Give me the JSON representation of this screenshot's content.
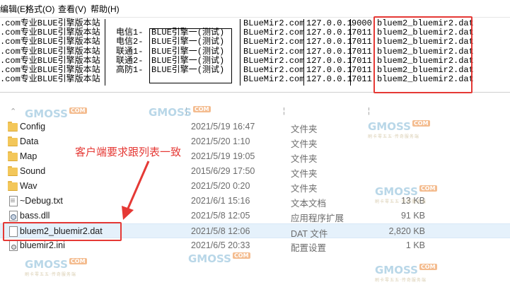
{
  "notepad": {
    "menu": [
      "编辑(E)",
      "格式(O)",
      "查看(V)",
      "帮助(H)"
    ],
    "lines": [
      {
        "site": ".com专业BLUE引擎版本站",
        "line_name": "",
        "engine": "",
        "domain": "BLueMir2.com",
        "ip": "127.0.0.1",
        "port": "9000",
        "file": "bluem2_bluemir2.dat"
      },
      {
        "site": ".com专业BLUE引擎版本站",
        "line_name": "电信1-",
        "engine": "BLUE引擎一(测试)",
        "domain": "BLueMir2.com",
        "ip": "127.0.0.1",
        "port": "7011",
        "file": "bluem2_bluemir2.dat"
      },
      {
        "site": ".com专业BLUE引擎版本站",
        "line_name": "电信2-",
        "engine": "BLUE引擎一(测试)",
        "domain": "BLueMir2.com",
        "ip": "127.0.0.1",
        "port": "7011",
        "file": "bluem2_bluemir2.dat"
      },
      {
        "site": ".com专业BLUE引擎版本站",
        "line_name": "联通1-",
        "engine": "BLUE引擎一(测试)",
        "domain": "BLueMir2.com",
        "ip": "127.0.0.1",
        "port": "7011",
        "file": "bluem2_bluemir2.dat"
      },
      {
        "site": ".com专业BLUE引擎版本站",
        "line_name": "联通2-",
        "engine": "BLUE引擎一(测试)",
        "domain": "BLueMir2.com",
        "ip": "127.0.0.1",
        "port": "7011",
        "file": "bluem2_bluemir2.dat"
      },
      {
        "site": ".com专业BLUE引擎版本站",
        "line_name": "高防1-",
        "engine": "BLUE引擎一(测试)",
        "domain": "BLueMir2.com",
        "ip": "127.0.0.1",
        "port": "7011",
        "file": "bluem2_bluemir2.dat"
      },
      {
        "site": ".com专业BLUE引擎版本站",
        "line_name": "",
        "engine": "",
        "domain": "BLueMir2.com",
        "ip": "127.0.0.1",
        "port": "7011",
        "file": "bluem2_bluemir2.dat"
      }
    ]
  },
  "explorer": {
    "files": [
      {
        "name": "Config",
        "date": "2021/5/19 16:47",
        "type": "文件夹",
        "size": "",
        "icon": "folder-icon"
      },
      {
        "name": "Data",
        "date": "2021/5/20 1:10",
        "type": "文件夹",
        "size": "",
        "icon": "folder-icon"
      },
      {
        "name": "Map",
        "date": "2021/5/19 19:05",
        "type": "文件夹",
        "size": "",
        "icon": "folder-icon"
      },
      {
        "name": "Sound",
        "date": "2015/6/29 17:50",
        "type": "文件夹",
        "size": "",
        "icon": "folder-icon"
      },
      {
        "name": "Wav",
        "date": "2021/5/20 0:20",
        "type": "文件夹",
        "size": "",
        "icon": "folder-icon"
      },
      {
        "name": "~Debug.txt",
        "date": "2021/6/1 15:16",
        "type": "文本文档",
        "size": "13 KB",
        "icon": "text-file-icon"
      },
      {
        "name": "bass.dll",
        "date": "2021/5/8 12:05",
        "type": "应用程序扩展",
        "size": "91 KB",
        "icon": "dll-file-icon"
      },
      {
        "name": "bluem2_bluemir2.dat",
        "date": "2021/5/8 12:06",
        "type": "DAT 文件",
        "size": "2,820 KB",
        "icon": "dat-file-icon"
      },
      {
        "name": "bluemir2.ini",
        "date": "2021/6/5 20:33",
        "type": "配置设置",
        "size": "1 KB",
        "icon": "ini-file-icon"
      }
    ]
  },
  "annotation": {
    "text": "客户端要求跟列表一致",
    "color": "#e53935"
  },
  "watermark": {
    "brand": "GMOSS",
    "badge": "COM",
    "tagline": "刷卡零五五·传奇服务端"
  },
  "colors": {
    "highlight": "#e53935",
    "selection": "#e5f1fb"
  }
}
